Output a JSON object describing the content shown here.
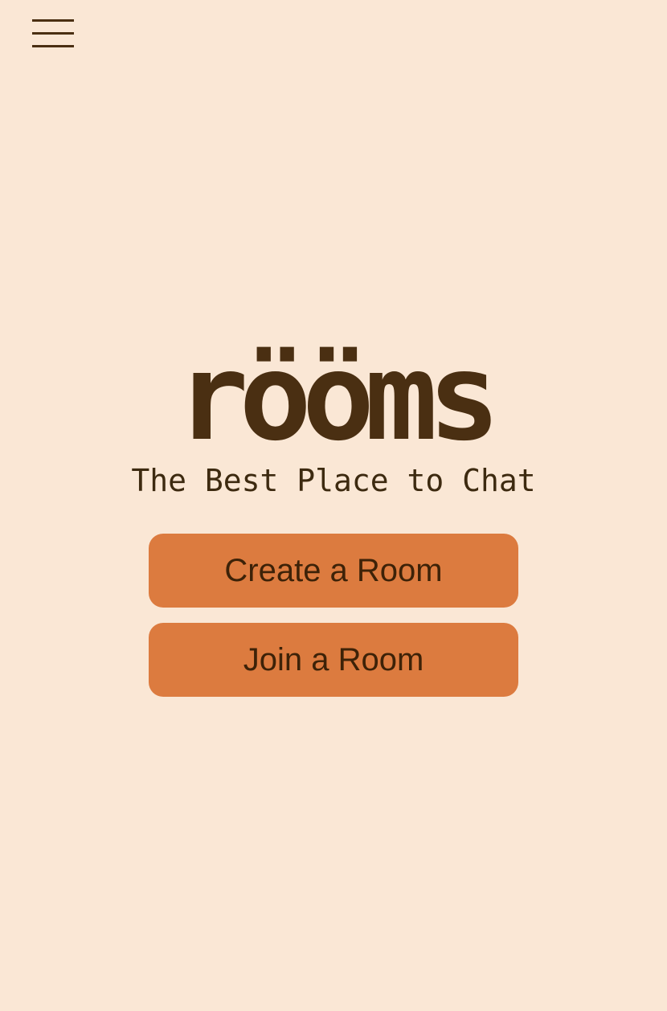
{
  "header": {
    "menu_icon": "hamburger-menu-icon"
  },
  "hero": {
    "logo_text": "rööms",
    "tagline": "The Best Place to Chat"
  },
  "actions": {
    "create_label": "Create a Room",
    "join_label": "Join a Room"
  },
  "colors": {
    "background": "#fae7d5",
    "brand_dark": "#4a2f12",
    "button": "#dc7b3f"
  }
}
